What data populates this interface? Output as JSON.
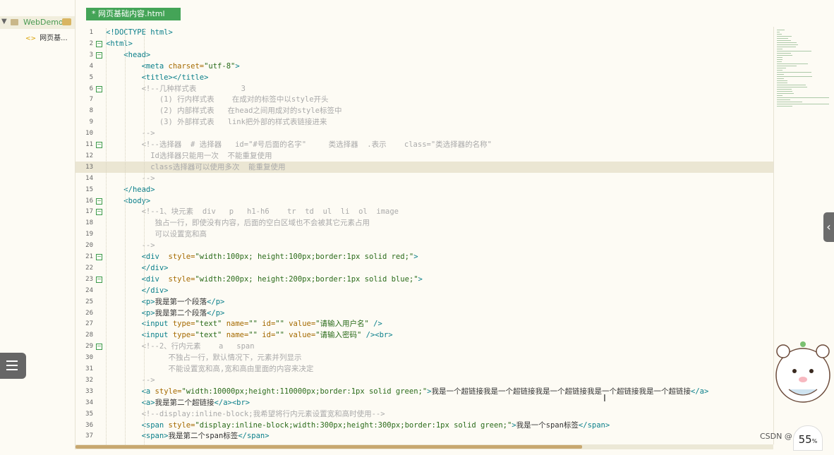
{
  "sidebar": {
    "project_name": "WebDemo",
    "file_name": "网页基..."
  },
  "tab": {
    "label": "* 网页基础内容.html"
  },
  "lines": [
    {
      "n": "1",
      "fold": false,
      "segs": [
        [
          "tag",
          "<!DOCTYPE html>"
        ]
      ]
    },
    {
      "n": "2",
      "fold": true,
      "segs": [
        [
          "tag",
          "<html>"
        ]
      ]
    },
    {
      "n": "3",
      "fold": true,
      "segs": [
        [
          "txt",
          "    "
        ],
        [
          "tag",
          "<head>"
        ]
      ]
    },
    {
      "n": "4",
      "fold": false,
      "segs": [
        [
          "txt",
          "        "
        ],
        [
          "tag",
          "<meta "
        ],
        [
          "attr",
          "charset="
        ],
        [
          "str",
          "\"utf-8\""
        ],
        [
          "tag",
          ">"
        ]
      ]
    },
    {
      "n": "5",
      "fold": false,
      "segs": [
        [
          "txt",
          "        "
        ],
        [
          "tag",
          "<title></title>"
        ]
      ]
    },
    {
      "n": "6",
      "fold": true,
      "segs": [
        [
          "txt",
          "        "
        ],
        [
          "cmt",
          "<!--几种样式表          3"
        ]
      ]
    },
    {
      "n": "7",
      "fold": false,
      "segs": [
        [
          "cmt",
          "            (1) 行内样式表    在成对的标签中以style开头"
        ]
      ]
    },
    {
      "n": "8",
      "fold": false,
      "segs": [
        [
          "cmt",
          "            (2) 内部样式表   在head之间用成对的style标签中"
        ]
      ]
    },
    {
      "n": "9",
      "fold": false,
      "segs": [
        [
          "cmt",
          "            (3) 外部样式表   link把外部的样式表链接进来"
        ]
      ]
    },
    {
      "n": "10",
      "fold": false,
      "segs": [
        [
          "cmt",
          "        -->"
        ]
      ]
    },
    {
      "n": "11",
      "fold": true,
      "segs": [
        [
          "txt",
          "        "
        ],
        [
          "cmt",
          "<!--选择器  # 选择器   id=\"#号后面的名字\"     类选择器  .表示    class=\"类选择器的名称\""
        ]
      ]
    },
    {
      "n": "12",
      "fold": false,
      "segs": [
        [
          "cmt",
          "          Id选择器只能用一次  不能重复使用"
        ]
      ]
    },
    {
      "n": "13",
      "fold": false,
      "hl": true,
      "segs": [
        [
          "cmt",
          "          class选择器可以使用多次  能重复使用"
        ]
      ]
    },
    {
      "n": "14",
      "fold": false,
      "segs": [
        [
          "cmt",
          "        -->"
        ]
      ]
    },
    {
      "n": "15",
      "fold": false,
      "segs": [
        [
          "txt",
          "    "
        ],
        [
          "tag",
          "</head>"
        ]
      ]
    },
    {
      "n": "16",
      "fold": true,
      "segs": [
        [
          "txt",
          "    "
        ],
        [
          "tag",
          "<body>"
        ]
      ]
    },
    {
      "n": "17",
      "fold": true,
      "segs": [
        [
          "txt",
          "        "
        ],
        [
          "cmt",
          "<!--1、块元素  div   p   h1-h6    tr  td  ul  li  ol  image"
        ]
      ]
    },
    {
      "n": "18",
      "fold": false,
      "segs": [
        [
          "cmt",
          "           独占一行，即使没有内容，后面的空白区域也不会被其它元素占用"
        ]
      ]
    },
    {
      "n": "19",
      "fold": false,
      "segs": [
        [
          "cmt",
          "           可以设置宽和高"
        ]
      ]
    },
    {
      "n": "20",
      "fold": false,
      "segs": [
        [
          "cmt",
          "        -->"
        ]
      ]
    },
    {
      "n": "21",
      "fold": true,
      "segs": [
        [
          "txt",
          "        "
        ],
        [
          "tag",
          "<div  "
        ],
        [
          "attr",
          "style="
        ],
        [
          "str",
          "\"width:100px; height:100px;border:1px solid red;\""
        ],
        [
          "tag",
          ">"
        ]
      ]
    },
    {
      "n": "22",
      "fold": false,
      "segs": [
        [
          "txt",
          "        "
        ],
        [
          "tag",
          "</div>"
        ]
      ]
    },
    {
      "n": "23",
      "fold": true,
      "segs": [
        [
          "txt",
          "        "
        ],
        [
          "tag",
          "<div  "
        ],
        [
          "attr",
          "style="
        ],
        [
          "str",
          "\"width:200px; height:200px;border:1px solid blue;\""
        ],
        [
          "tag",
          ">"
        ]
      ]
    },
    {
      "n": "24",
      "fold": false,
      "segs": [
        [
          "txt",
          "        "
        ],
        [
          "tag",
          "</div>"
        ]
      ]
    },
    {
      "n": "25",
      "fold": false,
      "segs": [
        [
          "txt",
          "        "
        ],
        [
          "tag",
          "<p>"
        ],
        [
          "txt",
          "我是第一个段落"
        ],
        [
          "tag",
          "</p>"
        ]
      ]
    },
    {
      "n": "26",
      "fold": false,
      "segs": [
        [
          "txt",
          "        "
        ],
        [
          "tag",
          "<p>"
        ],
        [
          "txt",
          "我是第二个段落"
        ],
        [
          "tag",
          "</p>"
        ]
      ]
    },
    {
      "n": "27",
      "fold": false,
      "segs": [
        [
          "txt",
          "        "
        ],
        [
          "tag",
          "<input "
        ],
        [
          "attr",
          "type="
        ],
        [
          "str",
          "\"text\" "
        ],
        [
          "attr",
          "name="
        ],
        [
          "str",
          "\"\" "
        ],
        [
          "attr",
          "id="
        ],
        [
          "str",
          "\"\" "
        ],
        [
          "attr",
          "value="
        ],
        [
          "str",
          "\"请输入用户名\""
        ],
        [
          "tag",
          " />"
        ]
      ]
    },
    {
      "n": "28",
      "fold": false,
      "segs": [
        [
          "txt",
          "        "
        ],
        [
          "tag",
          "<input "
        ],
        [
          "attr",
          "type="
        ],
        [
          "str",
          "\"text\" "
        ],
        [
          "attr",
          "name="
        ],
        [
          "str",
          "\"\" "
        ],
        [
          "attr",
          "id="
        ],
        [
          "str",
          "\"\" "
        ],
        [
          "attr",
          "value="
        ],
        [
          "str",
          "\"请输入密码\""
        ],
        [
          "tag",
          " /><br>"
        ]
      ]
    },
    {
      "n": "29",
      "fold": true,
      "segs": [
        [
          "txt",
          "        "
        ],
        [
          "cmt",
          "<!--2、行内元素    a   span"
        ]
      ]
    },
    {
      "n": "30",
      "fold": false,
      "segs": [
        [
          "cmt",
          "              不独占一行，默认情况下，元素并列显示"
        ]
      ]
    },
    {
      "n": "31",
      "fold": false,
      "segs": [
        [
          "cmt",
          "              不能设置宽和高,宽和高由里面的内容来决定"
        ]
      ]
    },
    {
      "n": "32",
      "fold": false,
      "segs": [
        [
          "cmt",
          "        -->"
        ]
      ]
    },
    {
      "n": "33",
      "fold": false,
      "segs": [
        [
          "txt",
          "        "
        ],
        [
          "tag",
          "<a "
        ],
        [
          "attr",
          "style="
        ],
        [
          "str",
          "\"width:10000px;height:110000px;border:1px solid green;\""
        ],
        [
          "tag",
          ">"
        ],
        [
          "txt",
          "我是一个超链接我是一个超链接我是一个超链接我是一个超链接我是一个超链接"
        ],
        [
          "tag",
          "</a>"
        ]
      ]
    },
    {
      "n": "34",
      "fold": false,
      "segs": [
        [
          "txt",
          "        "
        ],
        [
          "tag",
          "<a>"
        ],
        [
          "txt",
          "我是第二个超链接"
        ],
        [
          "tag",
          "</a><br>"
        ]
      ]
    },
    {
      "n": "35",
      "fold": false,
      "segs": [
        [
          "txt",
          "        "
        ],
        [
          "cmt",
          "<!--display:inline-block;我希望将行内元素设置宽和高时使用-->"
        ]
      ]
    },
    {
      "n": "36",
      "fold": false,
      "segs": [
        [
          "txt",
          "        "
        ],
        [
          "tag",
          "<span "
        ],
        [
          "attr",
          "style="
        ],
        [
          "str",
          "\"display:inline-block;width:300px;height:300px;border:1px solid green;\""
        ],
        [
          "tag",
          ">"
        ],
        [
          "txt",
          "我是一个span标签"
        ],
        [
          "tag",
          "</span>"
        ]
      ]
    },
    {
      "n": "37",
      "fold": false,
      "segs": [
        [
          "txt",
          "        "
        ],
        [
          "tag",
          "<span>"
        ],
        [
          "txt",
          "我是第二个span标签"
        ],
        [
          "tag",
          "</span>"
        ]
      ]
    }
  ],
  "widgets": {
    "csdn": "CSDN @",
    "speed_value": "55",
    "speed_unit": "%"
  }
}
